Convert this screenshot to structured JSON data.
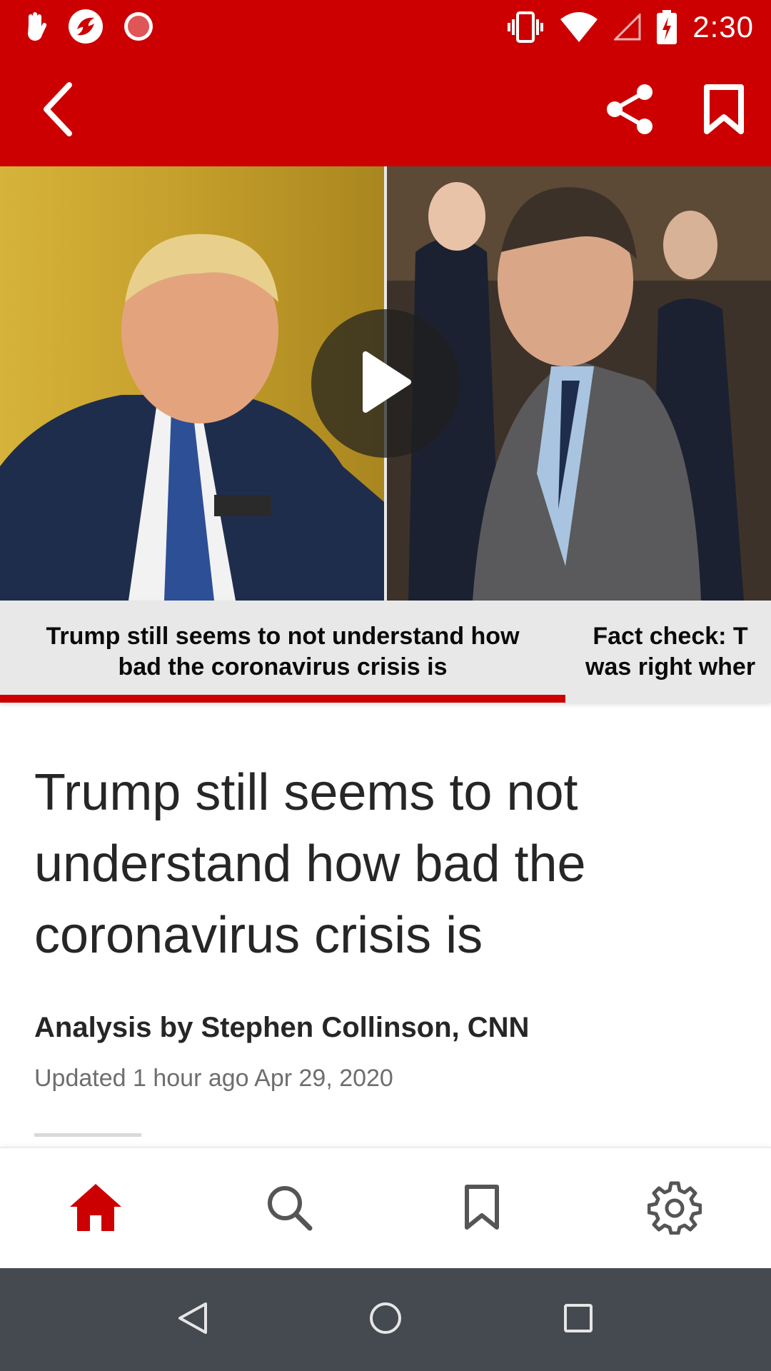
{
  "status_bar": {
    "time": "2:30",
    "left_icons": [
      "hand-icon",
      "app-logo-icon",
      "record-icon"
    ],
    "right_icons": [
      "vibrate-icon",
      "wifi-icon",
      "signal-icon",
      "battery-charging-icon"
    ]
  },
  "app_bar": {
    "color": "#cc0000",
    "icons": [
      "back-icon",
      "share-icon",
      "bookmark-icon"
    ]
  },
  "video": {
    "icon": "play-icon"
  },
  "carousel": {
    "items": [
      {
        "caption_line1": "Trump still seems to not understand how",
        "caption_line2": "bad the coronavirus crisis is"
      },
      {
        "caption_line1": "Fact check: T",
        "caption_line2": "was right wher"
      }
    ],
    "active_index": 0,
    "accent": "#cc0000"
  },
  "article": {
    "headline_line1": "Trump still seems to not",
    "headline_line2": "understand how bad the",
    "headline_line3": "coronavirus crisis is",
    "byline": "Analysis by Stephen Collinson, CNN",
    "updated": "Updated 1 hour ago Apr 29, 2020"
  },
  "tab_bar": {
    "tabs": [
      "home-icon",
      "search-icon",
      "bookmark-icon",
      "gear-icon"
    ],
    "active": "home-icon",
    "active_color": "#cc0000",
    "inactive_color": "#555555"
  },
  "nav_bar": {
    "icons": [
      "nav-back-icon",
      "nav-home-icon",
      "nav-recents-icon"
    ]
  }
}
